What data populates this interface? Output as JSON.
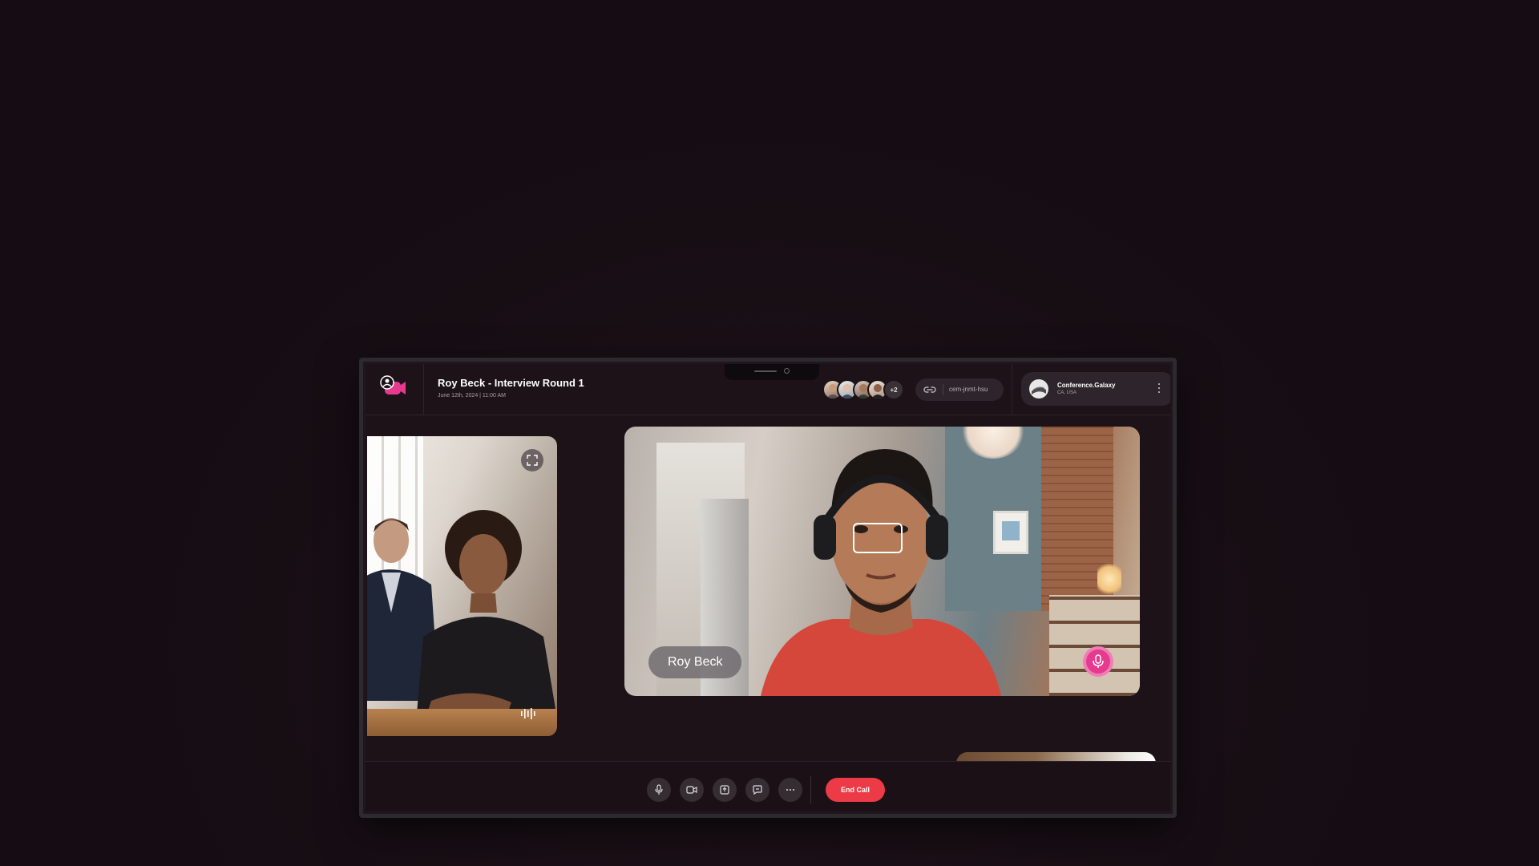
{
  "meeting": {
    "title": "Roy Beck - Interview Round 1",
    "datetime": "June 12th, 2024 | 11:00 AM"
  },
  "participants": {
    "avatar_count_shown": 4,
    "more_label": "+2"
  },
  "meeting_link": {
    "code": "cem-jnmt-hsu"
  },
  "organization": {
    "name": "Conference.Galaxy",
    "location": "CA, USA"
  },
  "main_speaker": {
    "name": "Roy Beck",
    "mic_state": "speaking"
  },
  "controls": {
    "end_call_label": "End Call",
    "buttons": [
      "microphone-icon",
      "video-camera-icon",
      "share-screen-icon",
      "chat-icon",
      "more-icon"
    ]
  },
  "colors": {
    "brand": "#e63a8f",
    "end_call": "#ec3b46",
    "background": "#150d13"
  }
}
